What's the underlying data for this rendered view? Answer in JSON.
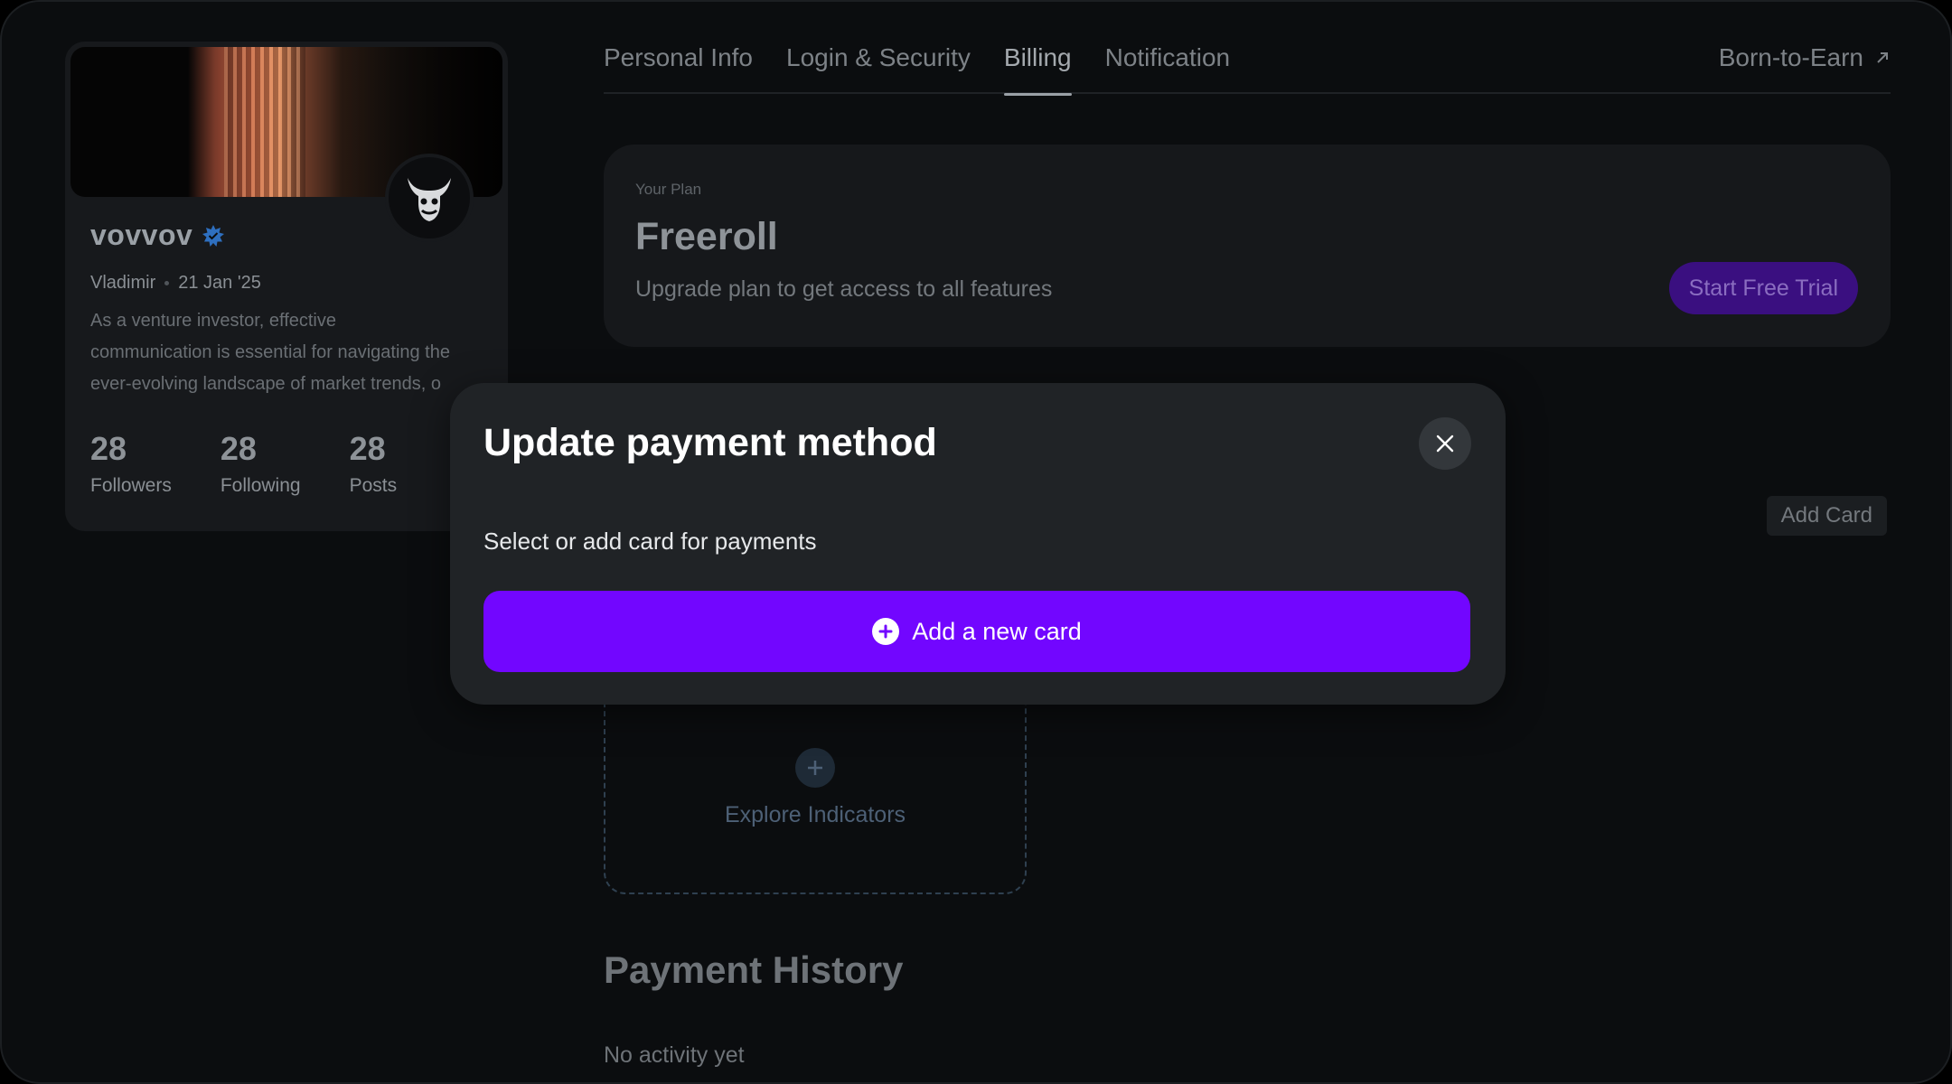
{
  "profile": {
    "username": "vovvov",
    "name": "Vladimir",
    "joined": "21 Jan '25",
    "bio_lines": [
      "As a venture investor, effective",
      "communication is essential for navigating the",
      "ever-evolving landscape of market trends, o"
    ],
    "stats": [
      {
        "value": "28",
        "label": "Followers"
      },
      {
        "value": "28",
        "label": "Following"
      },
      {
        "value": "28",
        "label": "Posts"
      }
    ]
  },
  "tabs": [
    {
      "label": "Personal Info",
      "active": false
    },
    {
      "label": "Login & Security",
      "active": false
    },
    {
      "label": "Billing",
      "active": true
    },
    {
      "label": "Notification",
      "active": false
    }
  ],
  "external_tab": {
    "label": "Born-to-Earn",
    "icon": "arrow-up-right-icon"
  },
  "plan": {
    "kicker": "Your Plan",
    "name": "Freeroll",
    "description": "Upgrade plan to get access to all features",
    "cta_label": "Start Free Trial"
  },
  "payment": {
    "add_card_label": "Add Card"
  },
  "indicators": {
    "explore_label": "Explore Indicators"
  },
  "history": {
    "title": "Payment History",
    "empty_text": "No activity yet"
  },
  "modal": {
    "title": "Update payment method",
    "subtitle": "Select or add card for payments",
    "add_new_card_label": "Add a new card",
    "close_icon": "close-icon"
  },
  "colors": {
    "accent": "#7206ff",
    "modal_bg": "#202326",
    "page_bg": "#0b0d0f"
  }
}
